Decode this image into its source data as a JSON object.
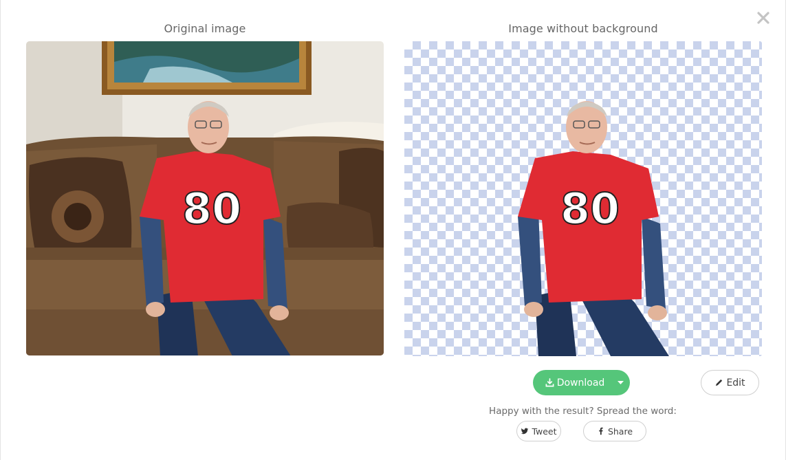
{
  "modal": {
    "left_title": "Original image",
    "right_title": "Image without background"
  },
  "photo": {
    "jersey_number": "80",
    "jersey_color": "#e02b33",
    "sofa_color": "#7a5a3a",
    "wall_color": "#ece9e2"
  },
  "checker": {
    "light": "#ffffff",
    "dark": "#c9d3ec"
  },
  "actions": {
    "download_label": "Download",
    "edit_label": "Edit",
    "accent_color": "#55c67a"
  },
  "social": {
    "prompt": "Happy with the result? Spread the word:",
    "tweet_label": "Tweet",
    "share_label": "Share"
  },
  "icons": {
    "close": "close-icon",
    "download": "download-icon",
    "caret": "chevron-down-icon",
    "edit": "pencil-icon",
    "twitter": "twitter-icon",
    "facebook": "facebook-icon"
  }
}
